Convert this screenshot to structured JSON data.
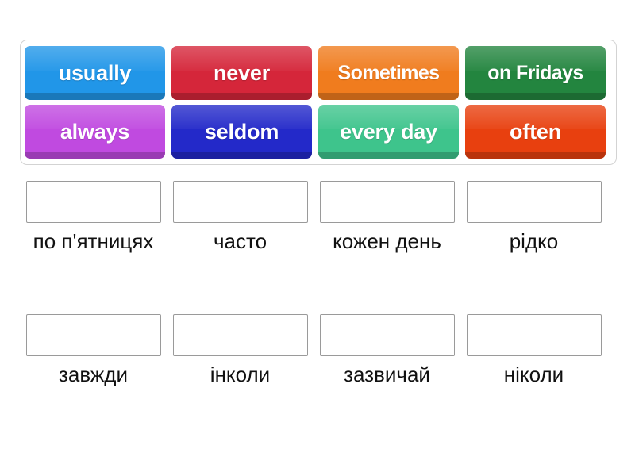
{
  "activity": {
    "type": "match-up-drag-and-drop",
    "background_color": "#ffffff",
    "tray_border_color": "#d3d3d3",
    "drop_zone_border_color": "#9a9a9a",
    "label_text_color": "#111111",
    "tile_text_color": "#ffffff"
  },
  "tiles": [
    {
      "label": "usually",
      "color": "#2196e8"
    },
    {
      "label": "never",
      "color": "#d5263a"
    },
    {
      "label": "Sometimes",
      "color": "#f07c1e"
    },
    {
      "label": "on Fridays",
      "color": "#23853f"
    },
    {
      "label": "always",
      "color": "#c04ae0"
    },
    {
      "label": "seldom",
      "color": "#2329c9"
    },
    {
      "label": "every day",
      "color": "#3ec48c"
    },
    {
      "label": "often",
      "color": "#e8400f"
    }
  ],
  "answers": {
    "row_1": [
      {
        "label": "по п'ятницях",
        "drop_zone_value": ""
      },
      {
        "label": "часто",
        "drop_zone_value": ""
      },
      {
        "label": "кожен день",
        "drop_zone_value": ""
      },
      {
        "label": "рідко",
        "drop_zone_value": ""
      }
    ],
    "row_2": [
      {
        "label": "завжди",
        "drop_zone_value": ""
      },
      {
        "label": "інколи",
        "drop_zone_value": ""
      },
      {
        "label": "зазвичай",
        "drop_zone_value": ""
      },
      {
        "label": "ніколи",
        "drop_zone_value": ""
      }
    ]
  }
}
